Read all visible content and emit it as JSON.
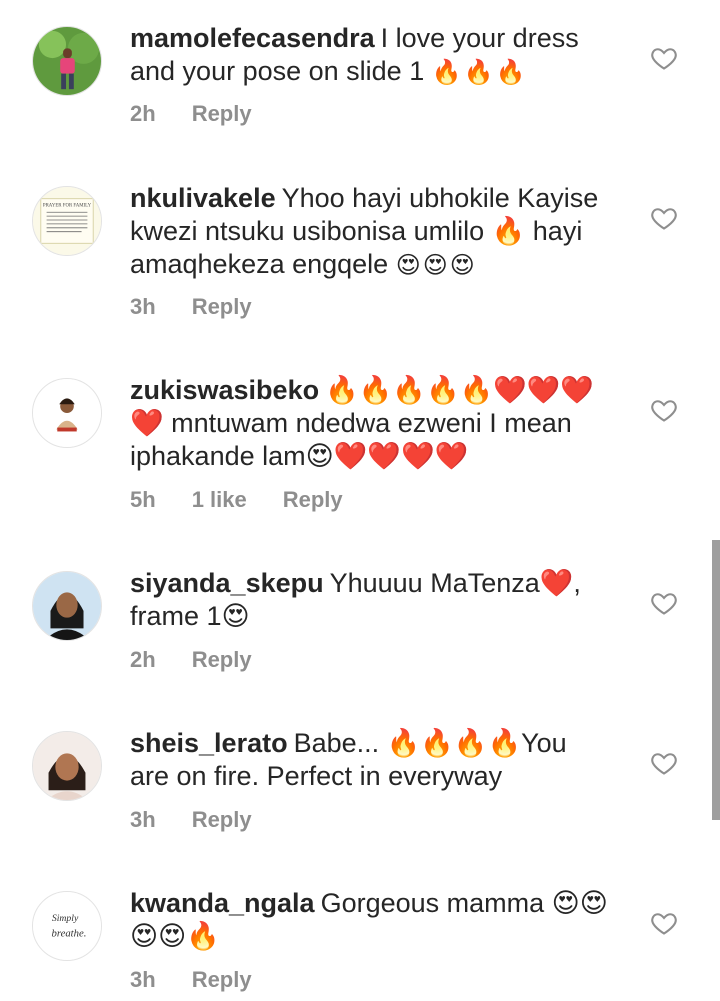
{
  "comments": [
    {
      "username": "mamolefecasendra",
      "text": "I love your dress and your pose on slide 1",
      "emojis": "🔥🔥🔥",
      "time": "2h",
      "likes": "",
      "reply": "Reply",
      "avatar_icon": "woman-in-garden-avatar"
    },
    {
      "username": "nkulivakele",
      "text": "Yhoo hayi ubhokile Kayise kwezi ntsuku usibonisa umlilo 🔥 hayi amaqhekeza engqele",
      "emojis": "😍😍😍",
      "time": "3h",
      "likes": "",
      "reply": "Reply",
      "avatar_icon": "prayer-card-avatar",
      "avatar_text": "PRAYER FOR FAMILY"
    },
    {
      "username": "zukiswasibeko",
      "text": "🔥🔥🔥🔥🔥❤️❤️❤️❤️ mntuwam ndedwa ezweni I mean iphakande lam😍❤️❤️❤️❤️",
      "emojis": "",
      "time": "5h",
      "likes": "1 like",
      "reply": "Reply",
      "avatar_icon": "woman-portrait-avatar"
    },
    {
      "username": "siyanda_skepu",
      "text": "Yhuuuu MaTenza❤️, frame 1😍",
      "emojis": "",
      "time": "2h",
      "likes": "",
      "reply": "Reply",
      "avatar_icon": "woman-selfie-avatar"
    },
    {
      "username": "sheis_lerato",
      "text": "Babe... 🔥🔥🔥🔥You are on fire. Perfect in everyway",
      "emojis": "",
      "time": "3h",
      "likes": "",
      "reply": "Reply",
      "avatar_icon": "woman-smiling-avatar"
    },
    {
      "username": "kwanda_ngala",
      "text": "Gorgeous mamma 😍😍😍😍🔥",
      "emojis": "",
      "time": "3h",
      "likes": "",
      "reply": "Reply",
      "avatar_icon": "simply-breathe-avatar",
      "avatar_text_1": "Simply",
      "avatar_text_2": "breathe."
    }
  ],
  "colors": {
    "text": "#262626",
    "meta": "#8e8e8e",
    "heart_stroke": "#8e8e8e"
  }
}
